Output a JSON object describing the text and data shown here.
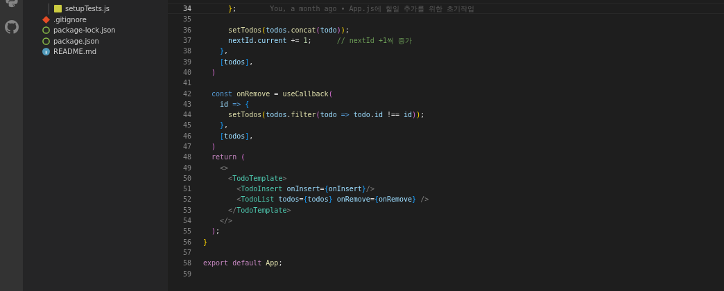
{
  "explorer": {
    "items": [
      {
        "children": [
          {
            "name": "setupTests.js",
            "kind": "js"
          }
        ]
      },
      {
        "name": ".gitignore",
        "kind": "git"
      },
      {
        "name": "package-lock.json",
        "kind": "npm"
      },
      {
        "name": "package.json",
        "kind": "npm"
      },
      {
        "name": "README.md",
        "kind": "info"
      }
    ]
  },
  "editor": {
    "lines": [
      {
        "number": "34",
        "current": true,
        "tokens": [
          {
            "kind": "b1",
            "t": "      }"
          },
          {
            "kind": "p",
            "t": ";"
          }
        ],
        "blame": "You, a month ago • App.js에 할일 추가를 위한 초기작업"
      },
      {
        "number": "35",
        "current": false
      },
      {
        "number": "36",
        "current": false,
        "tokens": [
          {
            "kind": "fn",
            "t": "      setTodos"
          },
          {
            "kind": "b1",
            "t": "("
          },
          {
            "kind": "v",
            "t": "todos"
          },
          {
            "kind": "p",
            "t": "."
          },
          {
            "kind": "fn",
            "t": "concat"
          },
          {
            "kind": "b2",
            "t": "("
          },
          {
            "kind": "v",
            "t": "todo"
          },
          {
            "kind": "b2",
            "t": ")"
          },
          {
            "kind": "b1",
            "t": ")"
          },
          {
            "kind": "p",
            "t": ";"
          }
        ]
      },
      {
        "number": "37",
        "current": false,
        "tokens": [
          {
            "kind": "v",
            "t": "      nextId"
          },
          {
            "kind": "p",
            "t": "."
          },
          {
            "kind": "v",
            "t": "current"
          },
          {
            "kind": "p",
            "t": " +="
          },
          {
            "kind": "n",
            "t": " 1"
          },
          {
            "kind": "p",
            "t": ";"
          },
          {
            "kind": "c",
            "t": "      // nextId +1씩 증가"
          }
        ]
      },
      {
        "number": "38",
        "current": false,
        "tokens": [
          {
            "kind": "b3",
            "t": "    }"
          },
          {
            "kind": "p",
            "t": ","
          }
        ]
      },
      {
        "number": "39",
        "current": false,
        "tokens": [
          {
            "kind": "b3",
            "t": "    ["
          },
          {
            "kind": "v",
            "t": "todos"
          },
          {
            "kind": "b3",
            "t": "]"
          },
          {
            "kind": "p",
            "t": ","
          }
        ]
      },
      {
        "number": "40",
        "current": false,
        "tokens": [
          {
            "kind": "b2",
            "t": "  )"
          }
        ]
      },
      {
        "number": "41",
        "current": false
      },
      {
        "number": "42",
        "current": false,
        "tokens": [
          {
            "kind": "st",
            "t": "  const"
          },
          {
            "kind": "fn",
            "t": " onRemove"
          },
          {
            "kind": "p",
            "t": " ="
          },
          {
            "kind": "fn",
            "t": " useCallback"
          },
          {
            "kind": "b2",
            "t": "("
          }
        ]
      },
      {
        "number": "43",
        "current": false,
        "tokens": [
          {
            "kind": "v",
            "t": "    id"
          },
          {
            "kind": "st",
            "t": " =>"
          },
          {
            "kind": "b3",
            "t": " {"
          }
        ]
      },
      {
        "number": "44",
        "current": false,
        "tokens": [
          {
            "kind": "fn",
            "t": "      setTodos"
          },
          {
            "kind": "b1",
            "t": "("
          },
          {
            "kind": "v",
            "t": "todos"
          },
          {
            "kind": "p",
            "t": "."
          },
          {
            "kind": "fn",
            "t": "filter"
          },
          {
            "kind": "b2",
            "t": "("
          },
          {
            "kind": "v",
            "t": "todo"
          },
          {
            "kind": "st",
            "t": " =>"
          },
          {
            "kind": "v",
            "t": " todo"
          },
          {
            "kind": "p",
            "t": "."
          },
          {
            "kind": "v",
            "t": "id"
          },
          {
            "kind": "p",
            "t": " !=="
          },
          {
            "kind": "v",
            "t": " id"
          },
          {
            "kind": "b2",
            "t": ")"
          },
          {
            "kind": "b1",
            "t": ")"
          },
          {
            "kind": "p",
            "t": ";"
          }
        ]
      },
      {
        "number": "45",
        "current": false,
        "tokens": [
          {
            "kind": "b3",
            "t": "    }"
          },
          {
            "kind": "p",
            "t": ","
          }
        ]
      },
      {
        "number": "46",
        "current": false,
        "tokens": [
          {
            "kind": "b3",
            "t": "    ["
          },
          {
            "kind": "v",
            "t": "todos"
          },
          {
            "kind": "b3",
            "t": "]"
          },
          {
            "kind": "p",
            "t": ","
          }
        ]
      },
      {
        "number": "47",
        "current": false,
        "tokens": [
          {
            "kind": "b2",
            "t": "  )"
          }
        ]
      },
      {
        "number": "48",
        "current": false,
        "tokens": [
          {
            "kind": "kw",
            "t": "  return"
          },
          {
            "kind": "b2",
            "t": " ("
          }
        ]
      },
      {
        "number": "49",
        "current": false,
        "tokens": [
          {
            "kind": "tp",
            "t": "    <>"
          }
        ]
      },
      {
        "number": "50",
        "current": false,
        "tokens": [
          {
            "kind": "tp",
            "t": "      <"
          },
          {
            "kind": "tg",
            "t": "TodoTemplate"
          },
          {
            "kind": "tp",
            "t": ">"
          }
        ]
      },
      {
        "number": "51",
        "current": false,
        "tokens": [
          {
            "kind": "tp",
            "t": "        <"
          },
          {
            "kind": "tg",
            "t": "TodoInsert"
          },
          {
            "kind": "v",
            "t": " onInsert"
          },
          {
            "kind": "p",
            "t": "="
          },
          {
            "kind": "b3",
            "t": "{"
          },
          {
            "kind": "v",
            "t": "onInsert"
          },
          {
            "kind": "b3",
            "t": "}"
          },
          {
            "kind": "tp",
            "t": "/>"
          }
        ]
      },
      {
        "number": "52",
        "current": false,
        "tokens": [
          {
            "kind": "tp",
            "t": "        <"
          },
          {
            "kind": "tg",
            "t": "TodoList"
          },
          {
            "kind": "v",
            "t": " todos"
          },
          {
            "kind": "p",
            "t": "="
          },
          {
            "kind": "b3",
            "t": "{"
          },
          {
            "kind": "v",
            "t": "todos"
          },
          {
            "kind": "b3",
            "t": "}"
          },
          {
            "kind": "v",
            "t": " onRemove"
          },
          {
            "kind": "p",
            "t": "="
          },
          {
            "kind": "b3",
            "t": "{"
          },
          {
            "kind": "v",
            "t": "onRemove"
          },
          {
            "kind": "b3",
            "t": "}"
          },
          {
            "kind": "tp",
            "t": " />"
          }
        ]
      },
      {
        "number": "53",
        "current": false,
        "tokens": [
          {
            "kind": "tp",
            "t": "      </"
          },
          {
            "kind": "tg",
            "t": "TodoTemplate"
          },
          {
            "kind": "tp",
            "t": ">"
          }
        ]
      },
      {
        "number": "54",
        "current": false,
        "tokens": [
          {
            "kind": "tp",
            "t": "    </>"
          }
        ]
      },
      {
        "number": "55",
        "current": false,
        "tokens": [
          {
            "kind": "b2",
            "t": "  )"
          },
          {
            "kind": "p",
            "t": ";"
          }
        ]
      },
      {
        "number": "56",
        "current": false,
        "tokens": [
          {
            "kind": "b1",
            "t": "}"
          }
        ]
      },
      {
        "number": "57",
        "current": false
      },
      {
        "number": "58",
        "current": false,
        "tokens": [
          {
            "kind": "kw",
            "t": "export"
          },
          {
            "kind": "kw",
            "t": " default"
          },
          {
            "kind": "fn",
            "t": " App"
          },
          {
            "kind": "p",
            "t": ";"
          }
        ]
      },
      {
        "number": "59",
        "current": false
      }
    ]
  }
}
